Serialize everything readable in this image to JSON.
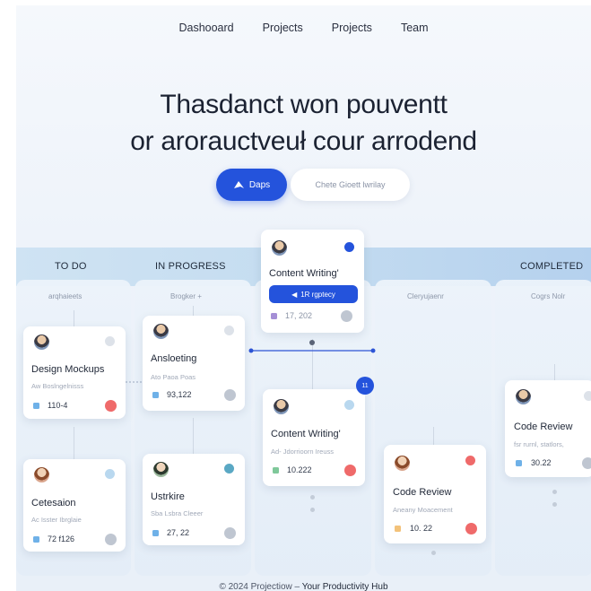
{
  "nav": {
    "items": [
      "Dashooard",
      "Projects",
      "Projects",
      "Team"
    ]
  },
  "hero": {
    "line1": "Thasdanct won pouventt",
    "line2": "or arorauctveuł cour arrodend",
    "primary_button": "Daps",
    "secondary_button": "Chete Gioett lwrilay"
  },
  "board": {
    "columns": [
      {
        "title": "TO DO",
        "subtitle": "arqhaieets"
      },
      {
        "title": "IN PROGRESS",
        "subtitle": "Brogker +"
      },
      {
        "title": "",
        "subtitle": "Cleryujaenr"
      },
      {
        "title": "COMPLETED",
        "subtitle": "Cogrs Nolr"
      }
    ],
    "floating_card": {
      "title": "Content Writing'",
      "tag": "1R rgptecy",
      "value": "17, 202"
    },
    "badge_count": "11",
    "cards": {
      "design_mockups": {
        "title": "Design Mockups",
        "sub": "Aw Boslngelnisss",
        "value": "110-4"
      },
      "cetesaion": {
        "title": "Cetesaion",
        "sub": "Ac Isster Ibrglaie",
        "value": "72 f126"
      },
      "ansloeting": {
        "title": "Ansloeting",
        "sub": "Ato Paoa Poas",
        "value": "93,122"
      },
      "ustrkire": {
        "title": "Ustrkire",
        "sub": "Sba Lsbra Cleeer",
        "value": "27, 22"
      },
      "content_writing": {
        "title": "Content Writing'",
        "sub": "Ad- Jdorrioorn Ireuss",
        "value": "10.222"
      },
      "code_review_mid": {
        "title": "Code Review",
        "sub": "Aneany Moacement",
        "value": "10. 22"
      },
      "code_review_right": {
        "title": "Code Review",
        "sub": "fsr rurnl, statlors,",
        "value": "30.22"
      }
    }
  },
  "footer": {
    "prefix": "© 2024 Projectiow –",
    "suffix": "Your Productivity Hub"
  },
  "colors": {
    "accent": "#2453dc",
    "dot_red": "#ef6a6a",
    "dot_grey": "#bfc6d1",
    "dot_blue": "#7fb6e6",
    "dot_teal": "#5aa8c4",
    "square_blue": "#6fb1e8",
    "square_purple": "#a58fd6",
    "square_green": "#7fc89a",
    "square_orange": "#f3c27a"
  }
}
